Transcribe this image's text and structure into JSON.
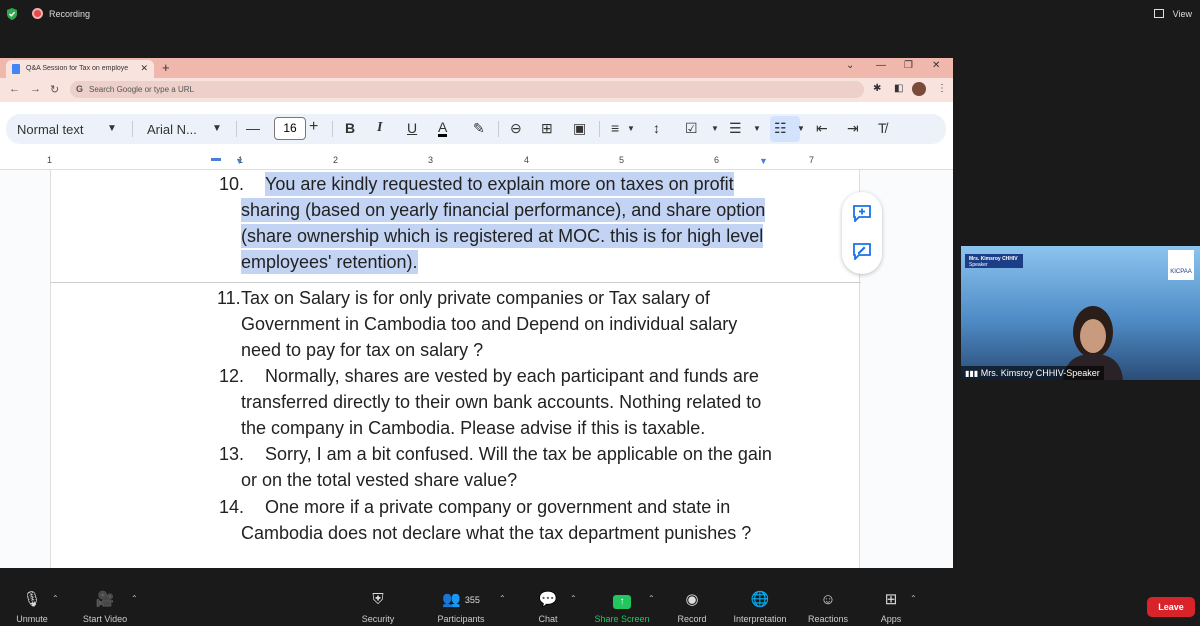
{
  "zoom_top": {
    "recording_label": "Recording",
    "view_label": "View"
  },
  "browser": {
    "tab_title": "Q&A Session for Tax on employe",
    "address_placeholder": "Search Google or type a URL"
  },
  "docs_toolbar": {
    "style_value": "Normal text",
    "font_value": "Arial N...",
    "font_size": "16"
  },
  "ruler": {
    "numbers": [
      "1",
      "1",
      "2",
      "3",
      "4",
      "5",
      "6",
      "7"
    ]
  },
  "document": {
    "items": [
      {
        "num": "10.",
        "lines": [
          "You are kindly requested to explain more on taxes on profit",
          "sharing (based on yearly financial performance), and share option",
          "(share ownership which is registered at MOC. this is for high level",
          "employees' retention)."
        ],
        "highlighted": true
      },
      {
        "num": "11.",
        "lines": [
          "Tax on Salary is for only private companies or Tax salary  of",
          "Government  in Cambodia too and Depend on individual salary",
          "need to pay for tax on salary ?"
        ],
        "highlighted": false
      },
      {
        "num": "12.",
        "lines": [
          "Normally, shares are vested by each participant and funds are",
          "transferred directly to their own bank accounts. Nothing related to",
          "the company in Cambodia. Please advise if this is taxable."
        ],
        "highlighted": false
      },
      {
        "num": "13.",
        "lines": [
          "Sorry, I am a bit confused. Will the tax be applicable on the gain",
          "or on the total vested share value?"
        ],
        "highlighted": false
      },
      {
        "num": "14.",
        "lines": [
          "One more if a private company or government and state in",
          "Cambodia does not declare what the tax department punishes ?"
        ],
        "highlighted": false
      }
    ]
  },
  "video": {
    "banner_name": "Mrs. Kimsroy CHHIV",
    "banner_role": "Speaker",
    "logo_text": "KICPAA",
    "participant_name": "Mrs. Kimsroy CHHIV-Speaker"
  },
  "zoom_bottom": {
    "unmute": "Unmute",
    "start_video": "Start Video",
    "security": "Security",
    "participants": "Participants",
    "participant_count": "355",
    "chat": "Chat",
    "share_screen": "Share Screen",
    "record": "Record",
    "interpretation": "Interpretation",
    "reactions": "Reactions",
    "apps": "Apps",
    "leave": "Leave"
  },
  "colors": {
    "highlight": "#c2d3f3",
    "share_green": "#22c55e",
    "leave_red": "#d8232a",
    "chrome_tab": "#f0b8ac"
  }
}
